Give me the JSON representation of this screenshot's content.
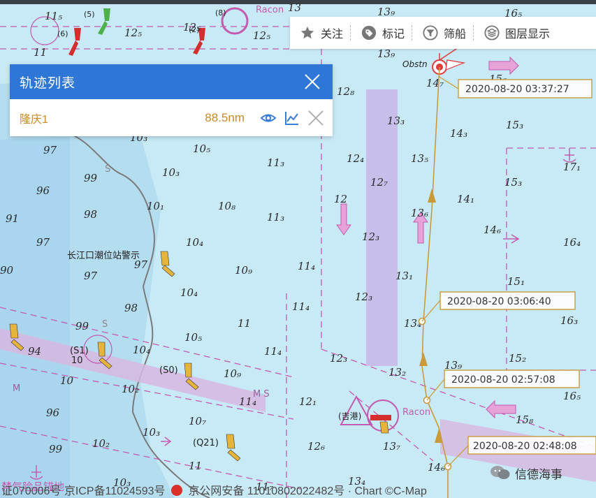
{
  "toolbar": {
    "items": [
      {
        "label": "关注",
        "icon": "star-icon"
      },
      {
        "label": "标记",
        "icon": "tag-icon"
      },
      {
        "label": "筛船",
        "icon": "filter-icon"
      },
      {
        "label": "图层显示",
        "icon": "layers-icon"
      }
    ]
  },
  "panel": {
    "title": "轨迹列表",
    "track": {
      "name": "隆庆1",
      "distance": "88.5nm"
    }
  },
  "track_times": [
    "2020-08-20 03:37:27",
    "2020-08-20 03:06:40",
    "2020-08-20 02:57:08",
    "2020-08-20 02:48:08"
  ],
  "map_labels": {
    "tide_station": "长江口潮位站警示",
    "racon_top": "Racon",
    "racon_mid": "Racon",
    "obstn": "Obstn",
    "s1": "(S1)",
    "s0": "(S0)",
    "q21": "(Q21)",
    "b5": "(5)",
    "b6": "(6)",
    "b8": "(8)",
    "b2": "(2)",
    "jiangzhu": "(吉港)",
    "ten": "10",
    "ms": "M S",
    "m": "M",
    "s_a": "S",
    "s_b": "S",
    "lower_text": "禁气险品锚地"
  },
  "footer": {
    "text_left": "证070006号 京ICP备11024593号",
    "text_right": "京公网安备 11010802022482号 · Chart ©C-Map"
  },
  "watermark": "信德海事",
  "colors": {
    "panel_header": "#2f77d7",
    "track_line": "#c99a3a",
    "track_text": "#c98a2a",
    "sea": "#c8eaf6",
    "channel": "#c9b8e8"
  }
}
